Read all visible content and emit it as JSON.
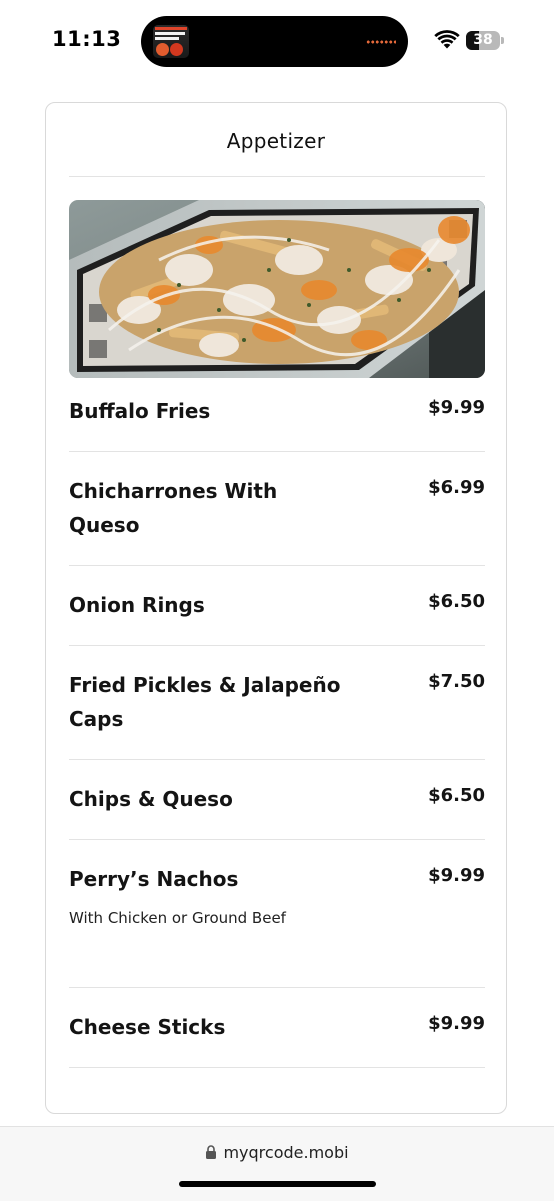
{
  "status_bar": {
    "time": "11:13",
    "battery": "38",
    "battery_level": 0.38
  },
  "menu": {
    "section_title": "Appetizer",
    "image_icon": "loaded-fries-photo",
    "items": [
      {
        "name": "Buffalo Fries",
        "price": "$9.99",
        "description": ""
      },
      {
        "name": "Chicharrones With Queso",
        "price": "$6.99",
        "description": ""
      },
      {
        "name": "Onion Rings",
        "price": "$6.50",
        "description": ""
      },
      {
        "name": "Fried Pickles & Jalapeño Caps",
        "price": "$7.50",
        "description": ""
      },
      {
        "name": "Chips & Queso",
        "price": "$6.50",
        "description": ""
      },
      {
        "name": "Perry’s Nachos",
        "price": "$9.99",
        "description": "With Chicken or Ground Beef"
      },
      {
        "name": "Cheese Sticks",
        "price": "$9.99",
        "description": ""
      }
    ]
  },
  "browser": {
    "url": "myqrcode.mobi"
  },
  "colors": {
    "card_border": "#d9d9d9",
    "divider": "#e3e3e3",
    "text": "#141414"
  }
}
